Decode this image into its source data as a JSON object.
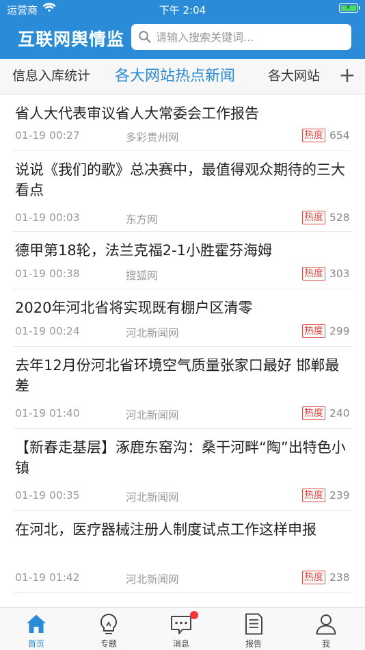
{
  "status_bar": {
    "carrier": "运营商",
    "time": "下午 2:04"
  },
  "header": {
    "title": "互联网舆情监",
    "search_placeholder": "请输入搜索关键词..."
  },
  "tabs": [
    {
      "label": "信息入库统计",
      "active": false
    },
    {
      "label": "各大网站热点新闻",
      "active": true
    },
    {
      "label": "各大网站",
      "active": false
    }
  ],
  "tab_add_label": "+",
  "hot_label": "热度",
  "news": [
    {
      "title": "省人大代表审议省人大常委会工作报告",
      "date": "01-19 00:27",
      "source": "多彩贵州网",
      "hot": "654"
    },
    {
      "title": "说说《我们的歌》总决赛中，最值得观众期待的三大看点",
      "date": "01-19 00:03",
      "source": "东方网",
      "hot": "528"
    },
    {
      "title": "德甲第18轮，法兰克福2-1小胜霍芬海姆",
      "date": "01-19 00:38",
      "source": "搜狐网",
      "hot": "303"
    },
    {
      "title": "2020年河北省将实现既有棚户区清零",
      "date": "01-19 00:24",
      "source": "河北新闻网",
      "hot": "299"
    },
    {
      "title": "去年12月份河北省环境空气质量张家口最好 邯郸最差",
      "date": "01-19 01:40",
      "source": "河北新闻网",
      "hot": "240"
    },
    {
      "title": "【新春走基层】涿鹿东窑沟：桑干河畔“陶”出特色小镇",
      "date": "01-19 00:35",
      "source": "河北新闻网",
      "hot": "239"
    },
    {
      "title": "在河北，医疗器械注册人制度试点工作这样申报",
      "date": "01-19 01:42",
      "source": "河北新闻网",
      "hot": "238"
    }
  ],
  "tabbar": [
    {
      "label": "首页",
      "icon": "home-icon",
      "active": true
    },
    {
      "label": "专题",
      "icon": "lightbulb-icon",
      "active": false
    },
    {
      "label": "消息",
      "icon": "message-icon",
      "active": false,
      "badge": true
    },
    {
      "label": "报告",
      "icon": "report-icon",
      "active": false
    },
    {
      "label": "我",
      "icon": "profile-icon",
      "active": false
    }
  ],
  "colors": {
    "brand": "#2a8bd8",
    "hot": "#e2473f",
    "badge": "#f4333c"
  }
}
